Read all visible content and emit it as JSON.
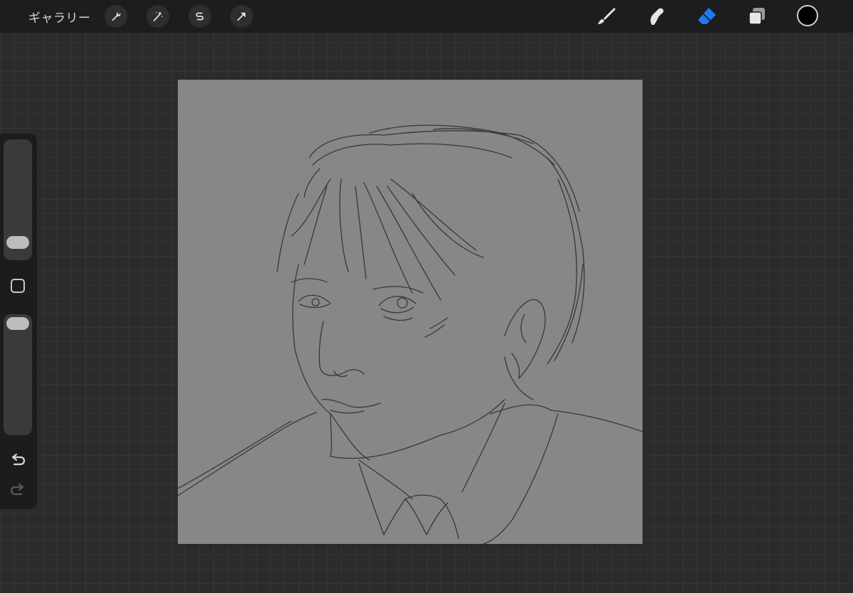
{
  "topbar": {
    "gallery_label": "ギャラリー",
    "left_tools": [
      "wrench-icon",
      "magic-wand-icon",
      "selection-s-icon",
      "transform-arrow-icon"
    ],
    "right_tools": [
      "brush-icon",
      "smudge-icon",
      "eraser-icon",
      "layers-icon"
    ],
    "active_tool": "eraser-icon",
    "accent_color": "#1a7cf5",
    "current_color": "#000000"
  },
  "sidebar": {
    "brush_size_level": 0.1,
    "opacity_level": 1.0,
    "controls": [
      "undo-icon",
      "redo-icon",
      "modify-square-icon"
    ]
  },
  "canvas": {
    "background": "#878787",
    "content": "pencil-sketch-portrait"
  }
}
